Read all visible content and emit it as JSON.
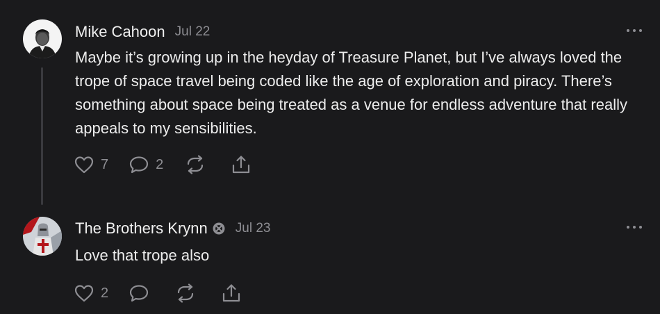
{
  "comments": [
    {
      "author": "Mike Cahoon",
      "date": "Jul 22",
      "text": "Maybe it’s growing up in the heyday of Treasure Planet, but I’ve always loved the trope of space travel being coded like the age of exploration and piracy. There’s something about space being treated as a venue for endless adventure that really appeals to my sensibilities.",
      "likes": "7",
      "replies": "2",
      "icons": [
        "heart-icon",
        "comment-icon",
        "restack-icon",
        "share-icon",
        "more-icon"
      ]
    },
    {
      "author": "The Brothers Krynn",
      "date": "Jul 23",
      "text": "Love that trope also",
      "likes": "2",
      "replies": "",
      "icons": [
        "verified-badge-icon",
        "heart-icon",
        "comment-icon",
        "restack-icon",
        "share-icon",
        "more-icon"
      ]
    }
  ],
  "colors": {
    "background": "#1a1a1c",
    "text": "#ededed",
    "muted": "#8e8e93",
    "thread_line": "#3a3a3e"
  }
}
